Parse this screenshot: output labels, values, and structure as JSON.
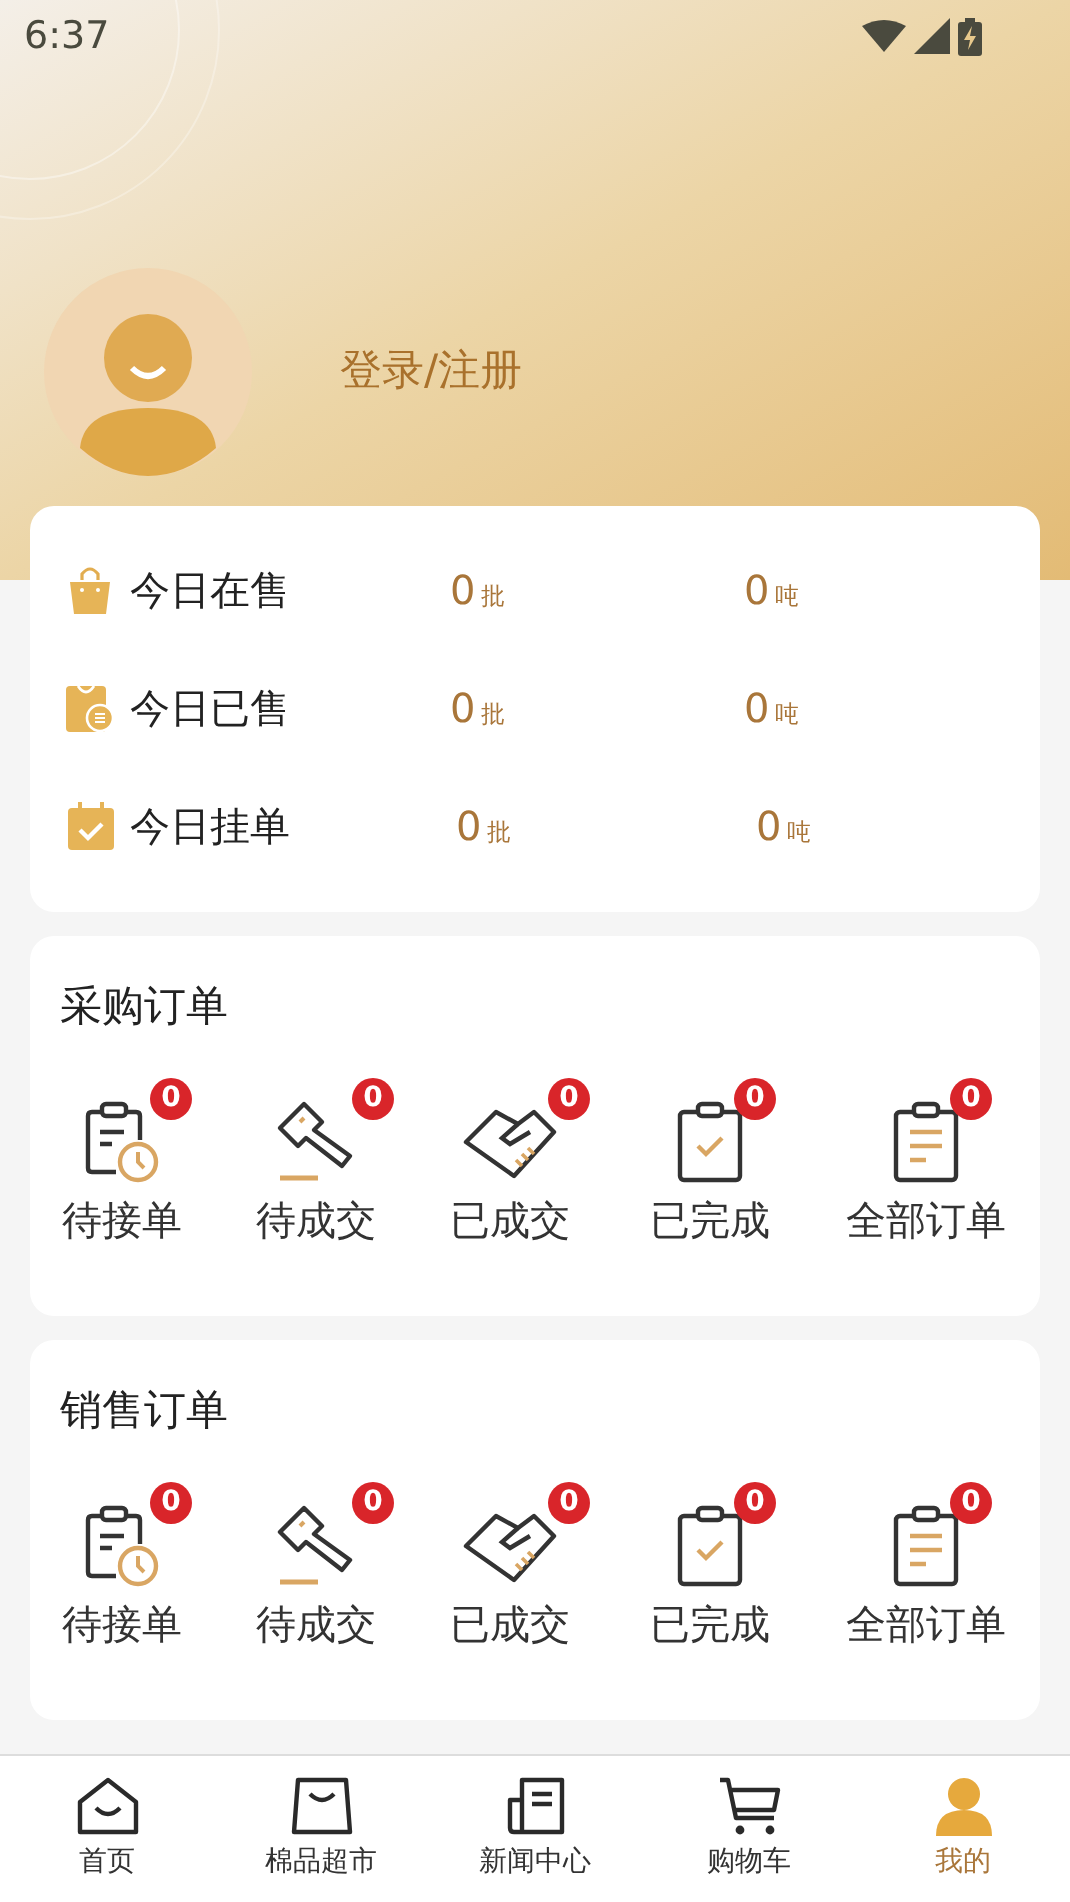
{
  "status_bar": {
    "time": "6:37"
  },
  "profile": {
    "login_label": "登录/注册"
  },
  "today_stats": [
    {
      "kind": "on_sale",
      "label": "今日在售",
      "batches": "0",
      "batch_unit": "批",
      "tons": "0",
      "ton_unit": "吨"
    },
    {
      "kind": "sold",
      "label": "今日已售",
      "batches": "0",
      "batch_unit": "批",
      "tons": "0",
      "ton_unit": "吨"
    },
    {
      "kind": "listed",
      "label": "今日挂单",
      "batches": "0",
      "batch_unit": "批",
      "tons": "0",
      "ton_unit": "吨"
    }
  ],
  "order_sections": [
    {
      "title": "采购订单",
      "items": [
        {
          "kind": "pending_accept",
          "label": "待接单",
          "count": "0"
        },
        {
          "kind": "pending_deal",
          "label": "待成交",
          "count": "0"
        },
        {
          "kind": "dealt",
          "label": "已成交",
          "count": "0"
        },
        {
          "kind": "completed",
          "label": "已完成",
          "count": "0"
        },
        {
          "kind": "all",
          "label": "全部订单",
          "count": "0"
        }
      ]
    },
    {
      "title": "销售订单",
      "items": [
        {
          "kind": "pending_accept",
          "label": "待接单",
          "count": "0"
        },
        {
          "kind": "pending_deal",
          "label": "待成交",
          "count": "0"
        },
        {
          "kind": "dealt",
          "label": "已成交",
          "count": "0"
        },
        {
          "kind": "completed",
          "label": "已完成",
          "count": "0"
        },
        {
          "kind": "all",
          "label": "全部订单",
          "count": "0"
        }
      ]
    }
  ],
  "bottom_nav": [
    {
      "kind": "home",
      "label": "首页",
      "selected": false
    },
    {
      "kind": "market",
      "label": "棉品超市",
      "selected": false
    },
    {
      "kind": "news",
      "label": "新闻中心",
      "selected": false
    },
    {
      "kind": "cart",
      "label": "购物车",
      "selected": false
    },
    {
      "kind": "mine",
      "label": "我的",
      "selected": true
    }
  ]
}
